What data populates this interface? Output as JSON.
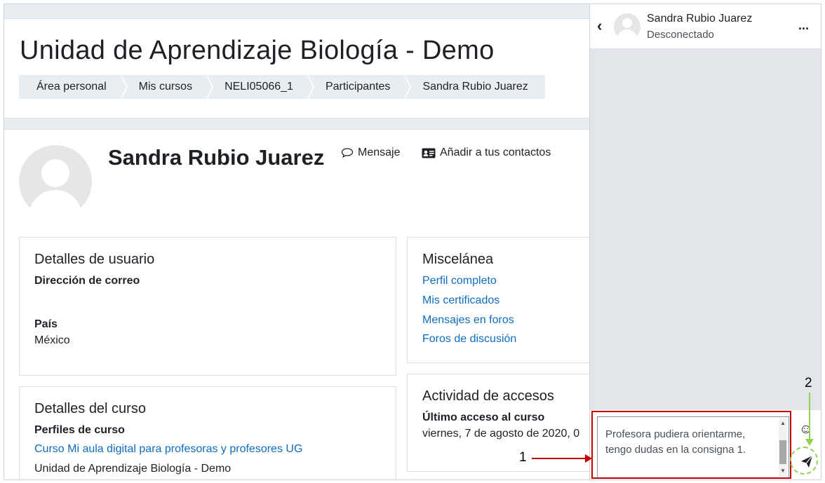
{
  "page": {
    "title": "Unidad de Aprendizaje Biología - Demo"
  },
  "breadcrumb": [
    "Área personal",
    "Mis cursos",
    "NELI05066_1",
    "Participantes",
    "Sandra Rubio Juarez"
  ],
  "profile": {
    "name": "Sandra Rubio Juarez",
    "message_label": "Mensaje",
    "add_contact_label": "Añadir a tus contactos"
  },
  "user_details": {
    "heading": "Detalles de usuario",
    "email_label": "Dirección de correo",
    "email_value": "",
    "country_label": "País",
    "country_value": "México"
  },
  "misc": {
    "heading": "Miscelánea",
    "links": [
      "Perfil completo",
      "Mis certificados",
      "Mensajes en foros",
      "Foros de discusión"
    ]
  },
  "course_details": {
    "heading": "Detalles del curso",
    "profiles_label": "Perfiles de curso",
    "course_link": "Curso Mi aula digital para profesoras y profesores UG",
    "course_name": "Unidad de Aprendizaje Biología - Demo"
  },
  "access": {
    "heading": "Actividad de accesos",
    "last_access_label": "Último acceso al curso",
    "last_access_value": "viernes, 7 de agosto de 2020, 0"
  },
  "chat": {
    "name": "Sandra Rubio Juarez",
    "status": "Desconectado",
    "message_draft": "Profesora pudiera orientarme, tengo dudas en la consigna 1.",
    "more_label": "...",
    "emoji_glyph": "☺"
  },
  "annotations": {
    "one": "1",
    "two": "2"
  },
  "colors": {
    "link": "#0f6cbf",
    "annotation_red": "#c00000",
    "annotation_green": "#92d050",
    "page_bg": "#e8edf1"
  }
}
